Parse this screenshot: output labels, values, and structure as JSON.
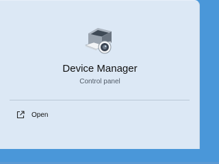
{
  "app": {
    "name": "Device Manager",
    "type": "Control panel",
    "icon": "device-manager-icon"
  },
  "actions": [
    {
      "label": "Open",
      "icon": "open-external-icon"
    }
  ],
  "colors": {
    "background": "#4a97d9",
    "panel": "#dce8f5",
    "divider": "#b9c7d6"
  }
}
